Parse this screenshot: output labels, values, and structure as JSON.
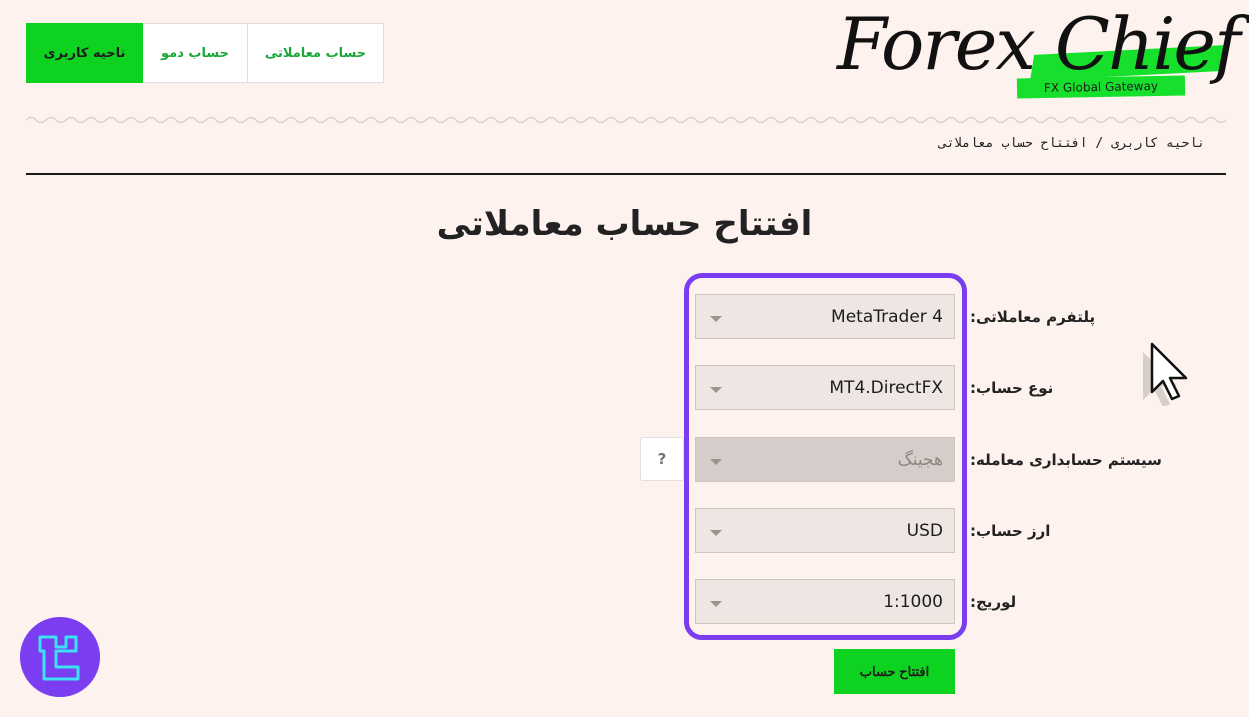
{
  "header": {
    "nav": {
      "user_area": "ناحیه کاربری",
      "demo_account": "حساب دمو",
      "trading_account": "حساب معاملاتی"
    },
    "logo": {
      "name": "Forex Chief",
      "tagline": "FX Global Gateway"
    }
  },
  "breadcrumb": "ناحیه کاربری  /  افتتاح حساب معاملاتی",
  "page_title": "افتتاح حساب معاملاتی",
  "form": {
    "platform": {
      "label": "پلتفرم معاملاتی:",
      "value": "MetaTrader 4"
    },
    "account_type": {
      "label": "نوع حساب:",
      "value": "MT4.DirectFX"
    },
    "accounting_system": {
      "label": "سیستم حسابداری معامله:",
      "value": "هجینگ",
      "help": "?"
    },
    "currency": {
      "label": "ارز حساب:",
      "value": "USD"
    },
    "leverage": {
      "label": "لوریج:",
      "value": "1:1000"
    },
    "submit_label": "افتتاح حساب"
  },
  "colors": {
    "background": "#fdf2ee",
    "accent_green": "#0dd21f",
    "highlight_purple": "#7a3df0"
  }
}
